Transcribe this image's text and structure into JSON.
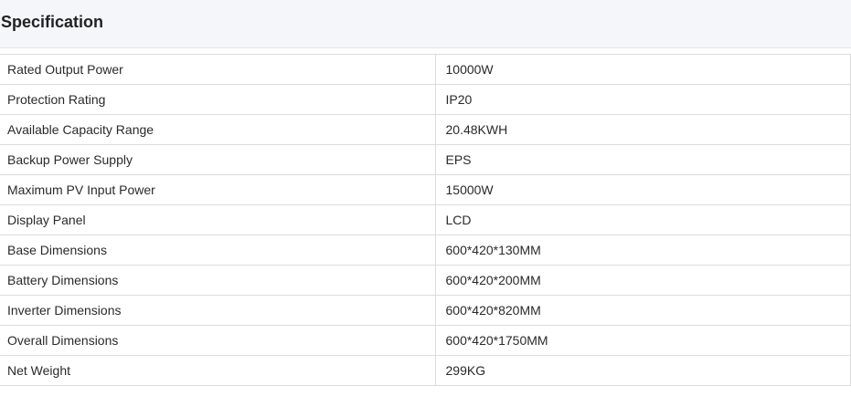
{
  "header": {
    "title": "Specification"
  },
  "spec_rows": [
    {
      "name": "Rated Output Power",
      "value": "10000W"
    },
    {
      "name": "Protection Rating",
      "value": "IP20"
    },
    {
      "name": "Available Capacity Range",
      "value": "20.48KWH"
    },
    {
      "name": "Backup Power Supply",
      "value": "EPS"
    },
    {
      "name": "Maximum PV Input Power",
      "value": "15000W"
    },
    {
      "name": "Display Panel",
      "value": "LCD"
    },
    {
      "name": "Base Dimensions",
      "value": "600*420*130MM"
    },
    {
      "name": "Battery Dimensions",
      "value": "600*420*200MM"
    },
    {
      "name": "Inverter Dimensions",
      "value": "600*420*820MM"
    },
    {
      "name": "Overall Dimensions",
      "value": "600*420*1750MM"
    },
    {
      "name": "Net Weight",
      "value": "299KG"
    }
  ]
}
